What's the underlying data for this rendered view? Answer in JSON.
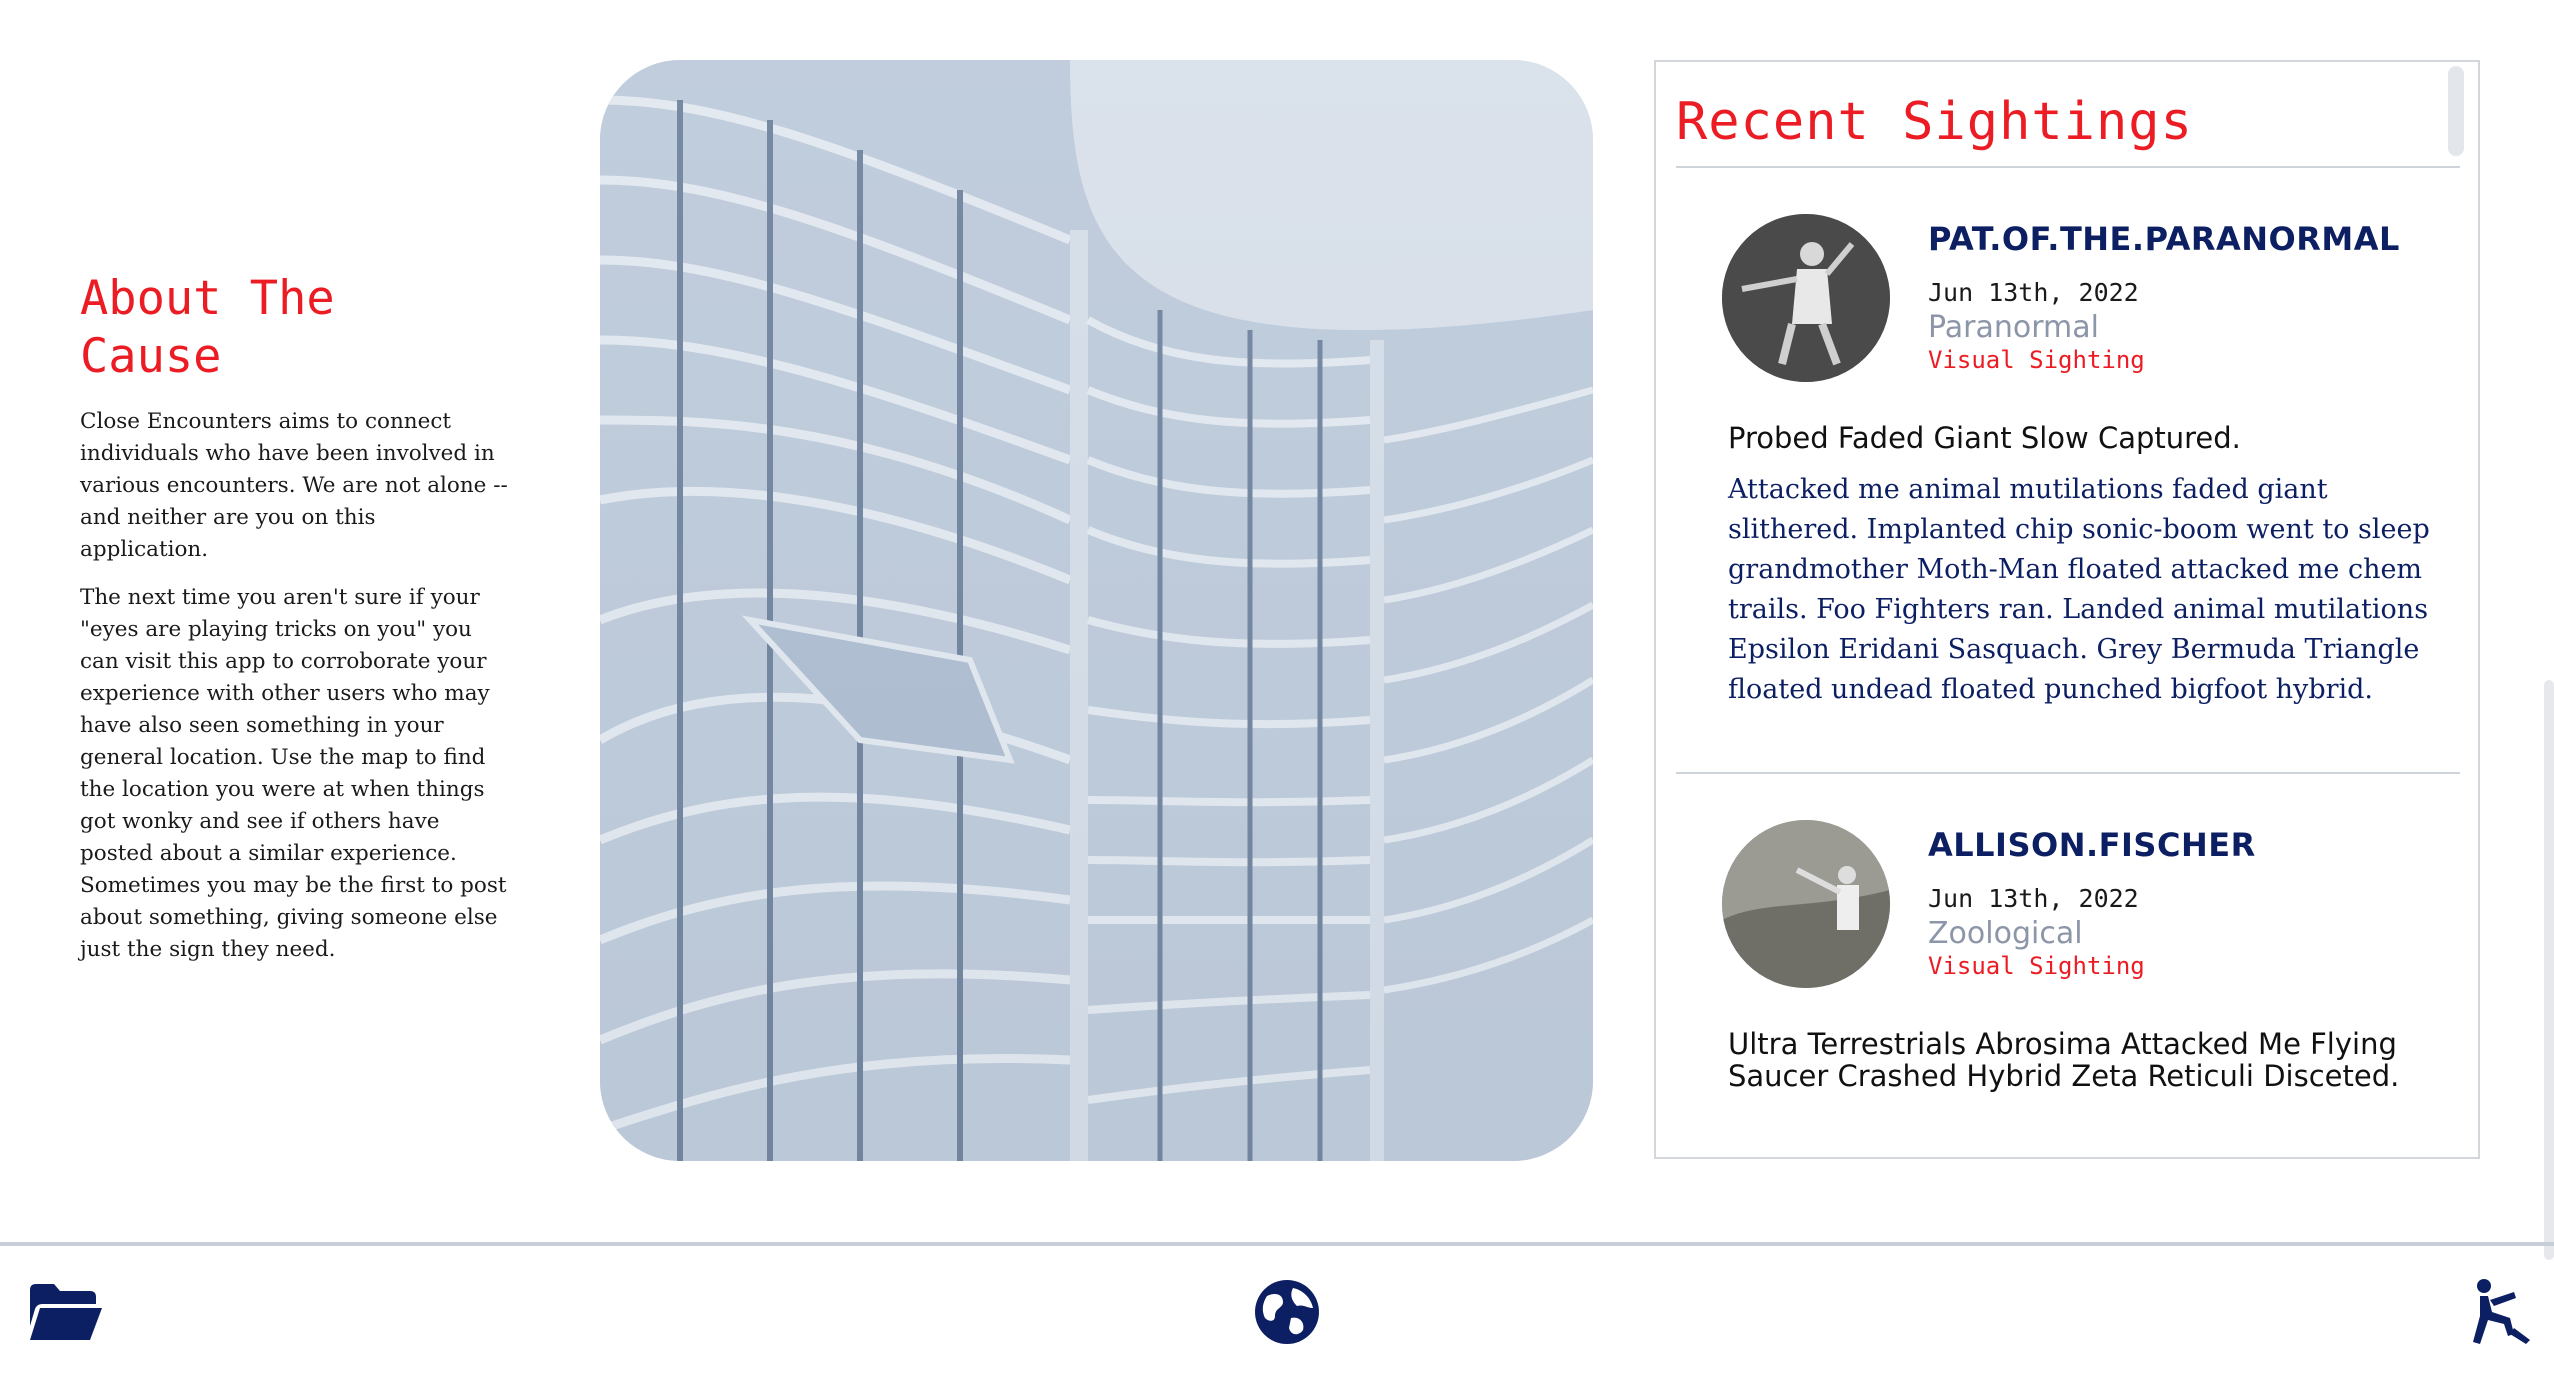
{
  "about": {
    "title": "About The Cause",
    "paragraphs": [
      "Close Encounters aims to connect individuals who have been involved in various encounters. We are not alone -- and neither are you on this application.",
      "The next time you aren't sure if your \"eyes are playing tricks on you\" you can visit this app to corroborate your experience with other users who may have also seen something in your general location. Use the map to find the location you were at when things got wonky and see if others have posted about a similar experience. Sometimes you may be the first to post about something, giving someone else just the sign they need."
    ]
  },
  "sightings": {
    "heading": "Recent Sightings",
    "posts": [
      {
        "username": "PAT.OF.THE.PARANORMAL",
        "date": "Jun 13th, 2022",
        "category": "Paranormal",
        "type": "Visual Sighting",
        "title": "Probed Faded Giant Slow Captured.",
        "body": "Attacked me animal mutilations faded giant slithered. Implanted chip sonic-boom went to sleep grandmother Moth-Man floated attacked me chem trails. Foo Fighters ran. Landed animal mutilations Epsilon Eridani Sasquach. Grey Bermuda Triangle floated undead floated punched bigfoot hybrid."
      },
      {
        "username": "ALLISON.FISCHER",
        "date": "Jun 13th, 2022",
        "category": "Zoological",
        "type": "Visual Sighting",
        "title": "Ultra Terrestrials Abrosima Attacked Me Flying Saucer Crashed Hybrid Zeta Reticuli Disceted."
      }
    ]
  },
  "nav": {
    "left_icon": "folder-open-icon",
    "center_icon": "globe-icon",
    "right_icon": "person-falling-icon"
  },
  "colors": {
    "accent_red": "#ec1c24",
    "navy": "#0d1f63",
    "muted": "#8c96a8"
  }
}
